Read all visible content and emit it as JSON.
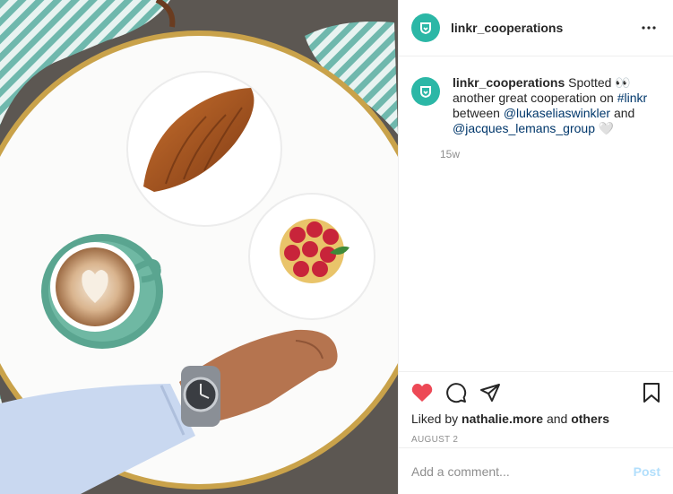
{
  "post": {
    "image_alt": "Top-down photo of a round white cafe table with a croissant, a raspberry tart, a cappuccino and a wrist with a watch",
    "accent_color": "#2bb7a6"
  },
  "header": {
    "username": "linkr_cooperations",
    "more_icon": "more-horizontal-icon"
  },
  "caption": {
    "username": "linkr_cooperations",
    "text_1": " Spotted ",
    "emoji": "👀",
    "text_2": " another great cooperation on ",
    "hashtag": "#linkr",
    "text_3": " between ",
    "mention_1": "@lukaseliaswinkler",
    "text_4": " and ",
    "mention_2": "@jacques_lemans_group",
    "emoji_end": "🤍",
    "time": "15w"
  },
  "actions": {
    "like_icon": "heart-filled-icon",
    "like_color": "#ed4956",
    "comment_icon": "comment-icon",
    "share_icon": "paper-plane-icon",
    "save_icon": "bookmark-icon"
  },
  "likes": {
    "prefix": "Liked by ",
    "user": "nathalie.more",
    "middle": " and ",
    "others": "others"
  },
  "date": "AUGUST 2",
  "comment": {
    "placeholder": "Add a comment...",
    "post_label": "Post"
  }
}
